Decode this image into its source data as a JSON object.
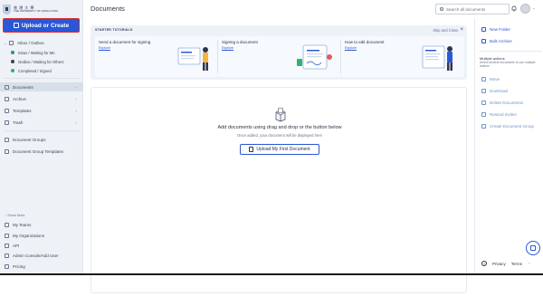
{
  "logo": {
    "cn": "香 港 大 學",
    "en": "THE UNIVERSITY OF HONG KONG"
  },
  "sidebar": {
    "upload_label": "Upload or Create",
    "inbox_outbox": "Inbox / Outbox",
    "sub_items": [
      {
        "label": "Inbox / Waiting for Me",
        "color": "#2f8f7e"
      },
      {
        "label": "Outbox / Waiting for Others",
        "color": "#3a4356"
      },
      {
        "label": "Completed / Signed",
        "color": "#2fb36e"
      }
    ],
    "items": [
      {
        "label": "Documents"
      },
      {
        "label": "Archive"
      },
      {
        "label": "Templates"
      },
      {
        "label": "Trash"
      }
    ],
    "groups": [
      {
        "label": "Document Groups"
      },
      {
        "label": "Document Group Templates"
      }
    ],
    "show_more": "Show More",
    "bottom": [
      {
        "label": "My Teams"
      },
      {
        "label": "My Organizations"
      },
      {
        "label": "API"
      },
      {
        "label": "Admin Console/Add User"
      },
      {
        "label": "Pricing"
      }
    ]
  },
  "header": {
    "title": "Documents",
    "search_placeholder": "Search all documents"
  },
  "tutorials": {
    "heading": "STARTER TUTORIALS",
    "skip_label": "Skip and Close",
    "cards": [
      {
        "title": "Send a document for signing",
        "link": "Explore"
      },
      {
        "title": "Signing a document",
        "link": "Explore"
      },
      {
        "title": "How to edit document",
        "link": "Explore"
      }
    ]
  },
  "dropzone": {
    "title": "Add documents using drag and drop or the button below",
    "subtitle": "Once added, your document will be displayed here",
    "button": "Upload My First Document"
  },
  "right_panel": {
    "new_folder": "New Folder",
    "bulk_archive": "Bulk Archive",
    "multiple_title": "Multiple actions",
    "multiple_desc": "Select several documents to use multiple actions",
    "actions": [
      {
        "label": "Move"
      },
      {
        "label": "Download"
      },
      {
        "label": "Delete Documents"
      },
      {
        "label": "Resend Invites"
      },
      {
        "label": "Create Document Group"
      }
    ],
    "footer": {
      "privacy": "Privacy",
      "terms": "Terms"
    }
  }
}
